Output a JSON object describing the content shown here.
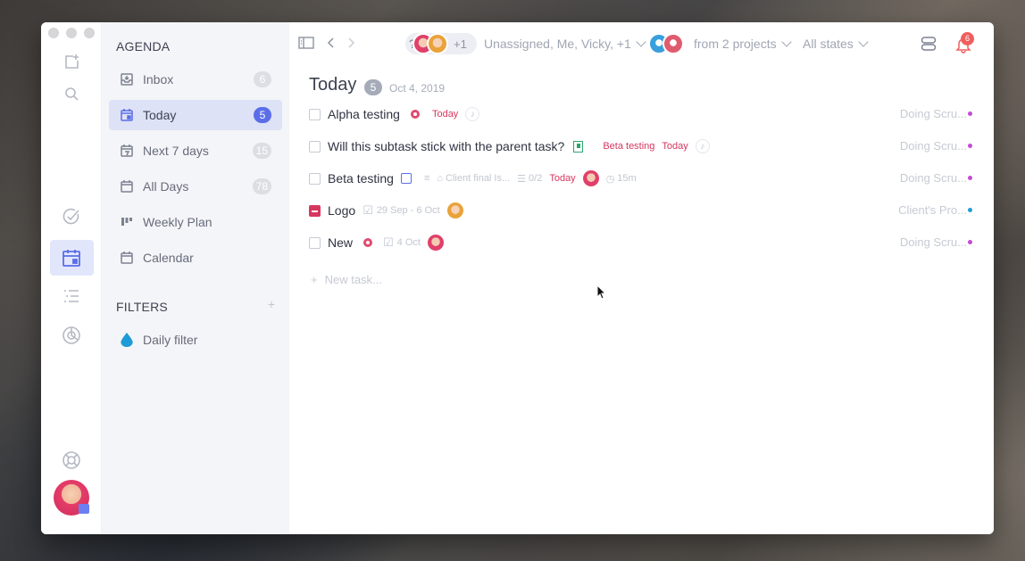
{
  "rail": {
    "icons": [
      "new-task-icon",
      "search-icon",
      "check-icon",
      "calendar-icon",
      "list-icon",
      "chart-icon",
      "help-icon"
    ]
  },
  "sidebar": {
    "agenda_title": "AGENDA",
    "items": [
      {
        "label": "Inbox",
        "count": "6",
        "icon": "inbox-icon"
      },
      {
        "label": "Today",
        "count": "5",
        "icon": "today-icon",
        "active": true
      },
      {
        "label": "Next 7 days",
        "count": "15",
        "icon": "week-icon"
      },
      {
        "label": "All Days",
        "count": "78",
        "icon": "calendar-icon"
      },
      {
        "label": "Weekly Plan",
        "count": "",
        "icon": "board-icon"
      },
      {
        "label": "Calendar",
        "count": "",
        "icon": "calendar-icon"
      }
    ],
    "filters_title": "FILTERS",
    "filters_add": "+",
    "filters": [
      {
        "label": "Daily filter",
        "icon": "drop-icon"
      }
    ]
  },
  "topbar": {
    "unknown_mark": "?",
    "assignee_more": "+1",
    "assignees_label": "Unassigned, Me, Vicky, +1",
    "projects_label": "from 2 projects",
    "states_label": "All states",
    "notifications_count": "6"
  },
  "main": {
    "title": "Today",
    "count": "5",
    "date": "Oct 4, 2019",
    "new_task_placeholder": "New task...",
    "tasks": [
      {
        "name": "Alpha testing",
        "due": "Today",
        "project": "Doing Scru...",
        "dot": "#c44bd4"
      },
      {
        "name": "Will this subtask stick with the parent task?",
        "parent": "Beta testing",
        "due": "Today",
        "project": "Doing Scru...",
        "dot": "#c44bd4"
      },
      {
        "name": "Beta testing",
        "comment": "Client final Is...",
        "checklist": "0/2",
        "due": "Today",
        "estimate": "15m",
        "project": "Doing Scru...",
        "dot": "#c44bd4"
      },
      {
        "name": "Logo",
        "range": "29 Sep - 6 Oct",
        "project": "Client's Pro...",
        "dot": "#1f9fd1"
      },
      {
        "name": "New",
        "date": "4 Oct",
        "project": "Doing Scru...",
        "dot": "#c44bd4"
      }
    ]
  },
  "colors": {
    "accent": "#5b6ee8",
    "danger": "#d6375f"
  }
}
